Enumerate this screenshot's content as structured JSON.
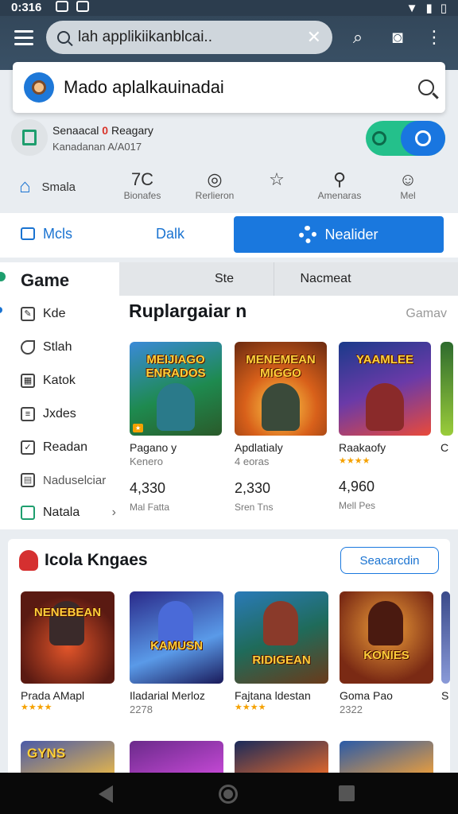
{
  "status": {
    "time": "0:316"
  },
  "browser": {
    "url_text": "lah applikiikanblcai..",
    "clear_glyph": "✕"
  },
  "search_card": {
    "text": "Mado aplalkauinadai"
  },
  "account": {
    "name_prefix": "Senaacal",
    "name_mark": "0",
    "name_suffix": "Reagary",
    "subtitle": "Kanadanan A/A017"
  },
  "tools": [
    {
      "icon": "home-icon",
      "label": "Smala"
    },
    {
      "icon": "70-glyph",
      "glyph": "7C",
      "label": "Bionafes"
    },
    {
      "icon": "clock-icon",
      "glyph": "◎",
      "label": "Rerlieron"
    },
    {
      "icon": "star-icon",
      "glyph": "☆",
      "label": ""
    },
    {
      "icon": "search-person-icon",
      "glyph": "⚲",
      "label": "Amenaras"
    },
    {
      "icon": "face-icon",
      "glyph": "☺",
      "label": "Mel"
    }
  ],
  "tabs": {
    "first": "Mcls",
    "second": "Dalk",
    "button": "Nealider"
  },
  "sidebar": {
    "title": "Game",
    "items": [
      {
        "label": "Kde",
        "icon": "edit-icon"
      },
      {
        "label": "Stlah",
        "icon": "tag-icon"
      },
      {
        "label": "Katok",
        "icon": "grid-icon"
      },
      {
        "label": "Jxdes",
        "icon": "list-icon"
      },
      {
        "label": "Readan",
        "icon": "check-icon"
      },
      {
        "label": "Naduselciar",
        "icon": "doc-icon"
      },
      {
        "label": "Natala",
        "icon": "game-icon",
        "chevron": "›"
      }
    ]
  },
  "main": {
    "subtabs": [
      "",
      "Ste",
      "Nacmeat",
      ""
    ],
    "section_title": "Ruplargaiar n",
    "section_more": "Gamav",
    "games": [
      {
        "logo": "MEIJIAGO ENRADOS",
        "name": "Pagano y",
        "sub": "Kenero",
        "count": "4,330",
        "caption": "Mal Fatta",
        "colors": [
          "#1e8a4f",
          "#f2b23a"
        ]
      },
      {
        "logo": "MENEMEAN MIGGO",
        "name": "Apdlatialy",
        "sub": "4 eoras",
        "count": "2,330",
        "caption": "Sren Tns",
        "colors": [
          "#c9471b",
          "#ffb03a"
        ]
      },
      {
        "logo": "YAAMLEE",
        "name": "Raakaofy",
        "sub": "★★★★",
        "count": "4,960",
        "caption": "Mell Pes",
        "colors": [
          "#2a55a8",
          "#e94a3a"
        ]
      },
      {
        "logo": "",
        "name": "C",
        "sub": "",
        "count": "",
        "caption": "",
        "colors": [
          "#2e6b2e",
          "#9acc3a"
        ]
      }
    ]
  },
  "section2": {
    "title": "Icola Kngaes",
    "button": "Seacarcdin",
    "games": [
      {
        "logo": "NENEBEAN",
        "name": "Prada AMapl",
        "meta": "★★★★",
        "colors": [
          "#5a1a12",
          "#e2552a"
        ]
      },
      {
        "logo": "KAMUSN",
        "name": "Iladarial Merloz",
        "meta": "2278",
        "colors": [
          "#2a2a8a",
          "#5a9ae8"
        ]
      },
      {
        "logo": "RIDIGEAN",
        "name": "Fajtana ldestan",
        "meta": "★★★★",
        "colors": [
          "#1f6b5a",
          "#e8c24a"
        ]
      },
      {
        "logo": "KONIES",
        "name": "Goma Pao",
        "meta": "2322",
        "colors": [
          "#7a2a14",
          "#f0a03a"
        ]
      },
      {
        "logo": "",
        "name": "S",
        "meta": "",
        "colors": [
          "#3a4a8a",
          "#8a9ad8"
        ]
      }
    ],
    "next_row": [
      {
        "logo": "GYNS",
        "colors": [
          "#4a5aa8",
          "#e8b84a"
        ]
      },
      {
        "logo": "",
        "colors": [
          "#6a2a8a",
          "#c84ad8"
        ]
      },
      {
        "logo": "",
        "colors": [
          "#1a2a5a",
          "#e86a2a"
        ]
      },
      {
        "logo": "",
        "colors": [
          "#2a5aa8",
          "#f0a03a"
        ]
      }
    ]
  },
  "colors": {
    "accent": "#1a78de",
    "toolbar": "#33475a",
    "star": "#f5a100"
  }
}
